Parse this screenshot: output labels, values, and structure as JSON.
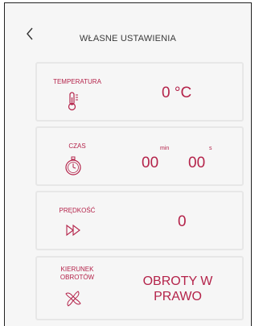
{
  "header": {
    "title": "WŁASNE USTAWIENIA"
  },
  "cards": {
    "temperature": {
      "label": "TEMPERATURA",
      "value": "0 °C",
      "icon": "thermometer-icon"
    },
    "time": {
      "label": "CZAS",
      "minutes": "00",
      "minutes_unit": "min",
      "seconds": "00",
      "seconds_unit": "s",
      "icon": "stopwatch-icon"
    },
    "speed": {
      "label": "PRĘDKOŚĆ",
      "value": "0",
      "icon": "fast-forward-icon"
    },
    "direction": {
      "label_line1": "KIERUNEK",
      "label_line2": "OBROTÓW",
      "value_line1": "OBROTY W",
      "value_line2": "PRAWO",
      "icon": "fan-rotation-icon"
    }
  },
  "colors": {
    "accent": "#b4234a",
    "card_border": "#e7e7e7",
    "background": "#f6f6f6"
  }
}
